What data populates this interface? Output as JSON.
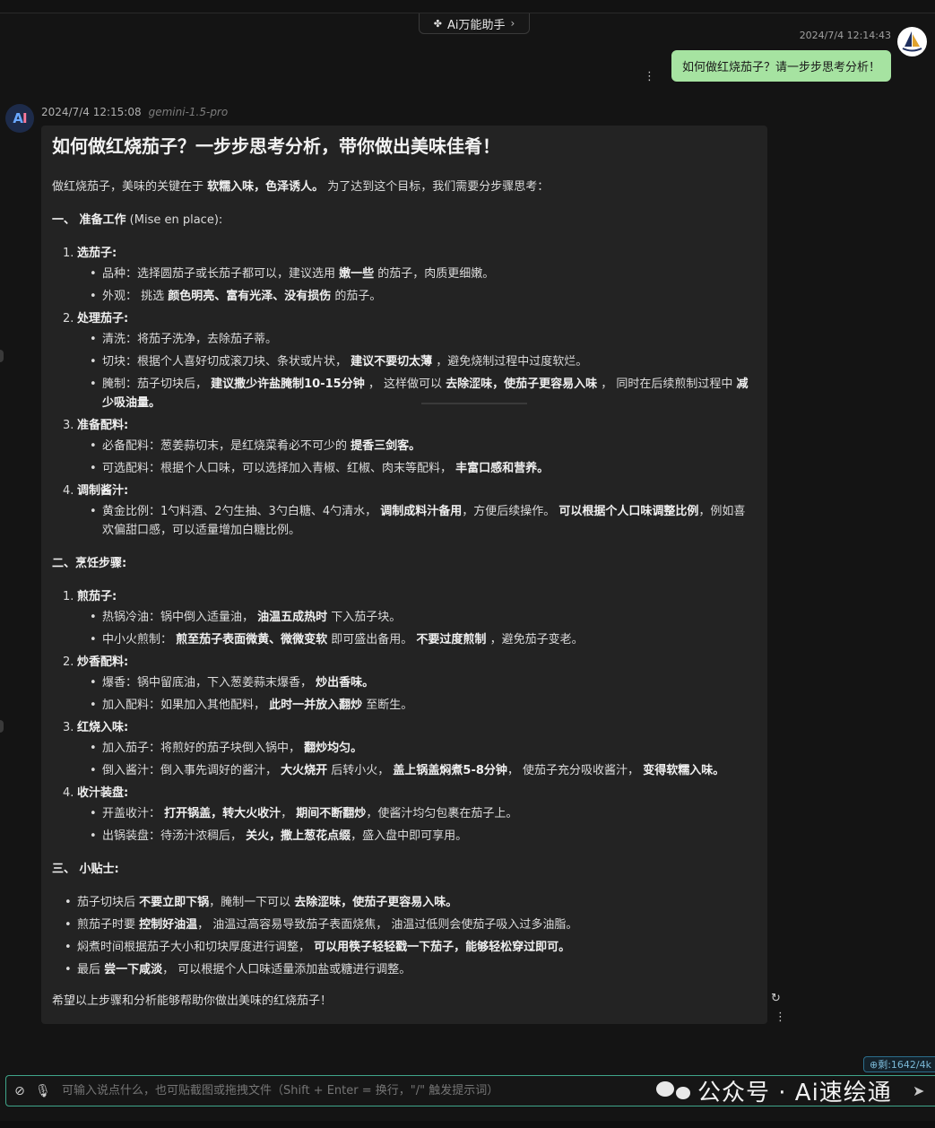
{
  "header": {
    "assistant_name": "Ai万能助手",
    "assistant_icon": "apps-icon",
    "chevron": "›"
  },
  "user_message": {
    "time": "2024/7/4 12:14:43",
    "text": "如何做红烧茄子？请一步步思考分析！",
    "bubble_color": "#a6e3a1"
  },
  "ai_message": {
    "avatar": [
      "A",
      "I"
    ],
    "time": "2024/7/4 12:15:08",
    "model": "gemini-1.5-pro",
    "title": "如何做红烧茄子？一步步思考分析，带你做出美味佳肴！",
    "intro": {
      "a": "做红烧茄子，美味的关键在于 ",
      "b": "软糯入味，色泽诱人。",
      "c": " 为了达到这个目标，我们需要分步骤思考："
    },
    "sec1": {
      "a": "一、 ",
      "b": "准备工作",
      "c": " (Mise en place):"
    },
    "prep": [
      {
        "num": "1.",
        "title": "选茄子:",
        "items": [
          {
            "a": "品种：选择圆茄子或长茄子都可以，建议选用 ",
            "b": "嫩一些",
            "c": " 的茄子，肉质更细嫩。"
          },
          {
            "a": "外观： 挑选 ",
            "b": "颜色明亮、富有光泽、没有损伤",
            "c": " 的茄子。"
          }
        ]
      },
      {
        "num": "2.",
        "title": "处理茄子:",
        "items": [
          {
            "a": "清洗：将茄子洗净，去除茄子蒂。",
            "b": "",
            "c": ""
          },
          {
            "a": "切块：根据个人喜好切成滚刀块、条状或片状， ",
            "b": "建议不要切太薄",
            "c": " ，避免烧制过程中过度软烂。"
          },
          {
            "a": "腌制：茄子切块后， ",
            "b": "建议撒少许盐腌制10-15分钟",
            "c": " ， 这样做可以 ",
            "d": "去除涩味，使茄子更容易入味",
            "e": " ， 同时在后续煎制过程中 ",
            "f": "减少吸油量。"
          }
        ]
      },
      {
        "num": "3.",
        "title": "准备配料:",
        "items": [
          {
            "a": "必备配料：葱姜蒜切末，是红烧菜肴必不可少的 ",
            "b": "提香三剑客。",
            "c": ""
          },
          {
            "a": "可选配料：根据个人口味，可以选择加入青椒、红椒、肉末等配料， ",
            "b": "丰富口感和营养。",
            "c": ""
          }
        ]
      },
      {
        "num": "4.",
        "title": "调制酱汁:",
        "items": [
          {
            "a": "黄金比例：1勺料酒、2勺生抽、3勺白糖、4勺清水， ",
            "b": "调制成料汁备用",
            "c": "，方便后续操作。 ",
            "d": "可以根据个人口味调整比例",
            "e": "，例如喜欢偏甜口感，可以适量增加白糖比例。",
            "f": ""
          }
        ]
      }
    ],
    "sec2": {
      "a": "二、",
      "b": "烹饪步骤:",
      "c": ""
    },
    "cook": [
      {
        "num": "1.",
        "title": "煎茄子:",
        "items": [
          {
            "a": "热锅冷油：锅中倒入适量油， ",
            "b": "油温五成热时",
            "c": " 下入茄子块。"
          },
          {
            "a": "中小火煎制： ",
            "b": "煎至茄子表面微黄、微微变软",
            "c": " 即可盛出备用。 ",
            "d": "不要过度煎制",
            "e": " ，避免茄子变老。"
          }
        ]
      },
      {
        "num": "2.",
        "title": "炒香配料:",
        "items": [
          {
            "a": "爆香：锅中留底油，下入葱姜蒜末爆香， ",
            "b": "炒出香味。",
            "c": ""
          },
          {
            "a": "加入配料：如果加入其他配料， ",
            "b": "此时一并放入翻炒",
            "c": " 至断生。"
          }
        ]
      },
      {
        "num": "3.",
        "title": "红烧入味:",
        "items": [
          {
            "a": "加入茄子：将煎好的茄子块倒入锅中， ",
            "b": "翻炒均匀。",
            "c": ""
          },
          {
            "a": "倒入酱汁：倒入事先调好的酱汁， ",
            "b": "大火烧开",
            "c": " 后转小火， ",
            "d": "盖上锅盖焖煮5-8分钟",
            "e": "， 使茄子充分吸收酱汁， ",
            "f": "变得软糯入味。"
          }
        ]
      },
      {
        "num": "4.",
        "title": "收汁装盘:",
        "items": [
          {
            "a": "开盖收汁： ",
            "b": "打开锅盖，转大火收汁",
            "c": "， ",
            "d": "期间不断翻炒",
            "e": "，使酱汁均匀包裹在茄子上。",
            "f": ""
          },
          {
            "a": "出锅装盘：待汤汁浓稠后， ",
            "b": "关火，撒上葱花点缀",
            "c": "，盛入盘中即可享用。"
          }
        ]
      }
    ],
    "sec3": {
      "a": "三、 ",
      "b": "小贴士:",
      "c": ""
    },
    "tips": [
      {
        "a": "茄子切块后 ",
        "b": "不要立即下锅",
        "c": "，腌制一下可以 ",
        "d": "去除涩味，使茄子更容易入味。",
        "e": ""
      },
      {
        "a": "煎茄子时要 ",
        "b": "控制好油温",
        "c": "， 油温过高容易导致茄子表面烧焦， 油温过低则会使茄子吸入过多油脂。",
        "d": "",
        "e": ""
      },
      {
        "a": "焖煮时间根据茄子大小和切块厚度进行调整， ",
        "b": "可以用筷子轻轻戳一下茄子，能够轻松穿过即可。",
        "c": "",
        "d": "",
        "e": ""
      },
      {
        "a": "最后 ",
        "b": "尝一下咸淡",
        "c": "， 可以根据个人口味适量添加盐或糖进行调整。",
        "d": "",
        "e": ""
      }
    ],
    "outro": "希望以上步骤和分析能够帮助你做出美味的红烧茄子！"
  },
  "composer": {
    "placeholder": "可输入说点什么，也可贴截图或拖拽文件（Shift + Enter = 换行，\"/\" 触发提示词）",
    "token_badge": "⊕剩:1642/4k",
    "attach_icon": "paperclip-icon",
    "mic_icon": "microphone-icon",
    "send_icon": "send-icon"
  },
  "watermark": "公众号 · Ai速绘通"
}
